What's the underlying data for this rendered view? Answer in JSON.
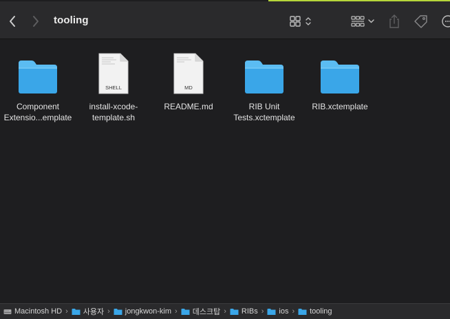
{
  "window": {
    "title": "tooling"
  },
  "toolbar": {
    "back_icon": "chevron-left-icon",
    "forward_icon": "chevron-right-icon",
    "view_icon": "icon-grid-view-icon",
    "group_icon": "group-by-icon",
    "share_icon": "share-icon",
    "tag_icon": "tag-icon",
    "more_icon": "more-icon"
  },
  "files": [
    {
      "name": "Component\nExtensio...emplate",
      "kind": "folder"
    },
    {
      "name": "install-xcode-\ntemplate.sh",
      "kind": "document",
      "badge": "SHELL"
    },
    {
      "name": "README.md",
      "kind": "document",
      "badge": "MD"
    },
    {
      "name": "RIB Unit\nTests.xctemplate",
      "kind": "folder"
    },
    {
      "name": "RIB.xctemplate",
      "kind": "folder"
    }
  ],
  "pathbar": {
    "crumbs": [
      "Macintosh HD",
      "사용자",
      "jongkwon-kim",
      "데스크탑",
      "RIBs",
      "ios",
      "tooling"
    ]
  },
  "colors": {
    "folder": "#3aa6e8",
    "folder_tab": "#5bbcf2",
    "accent": "#b6d63a"
  }
}
